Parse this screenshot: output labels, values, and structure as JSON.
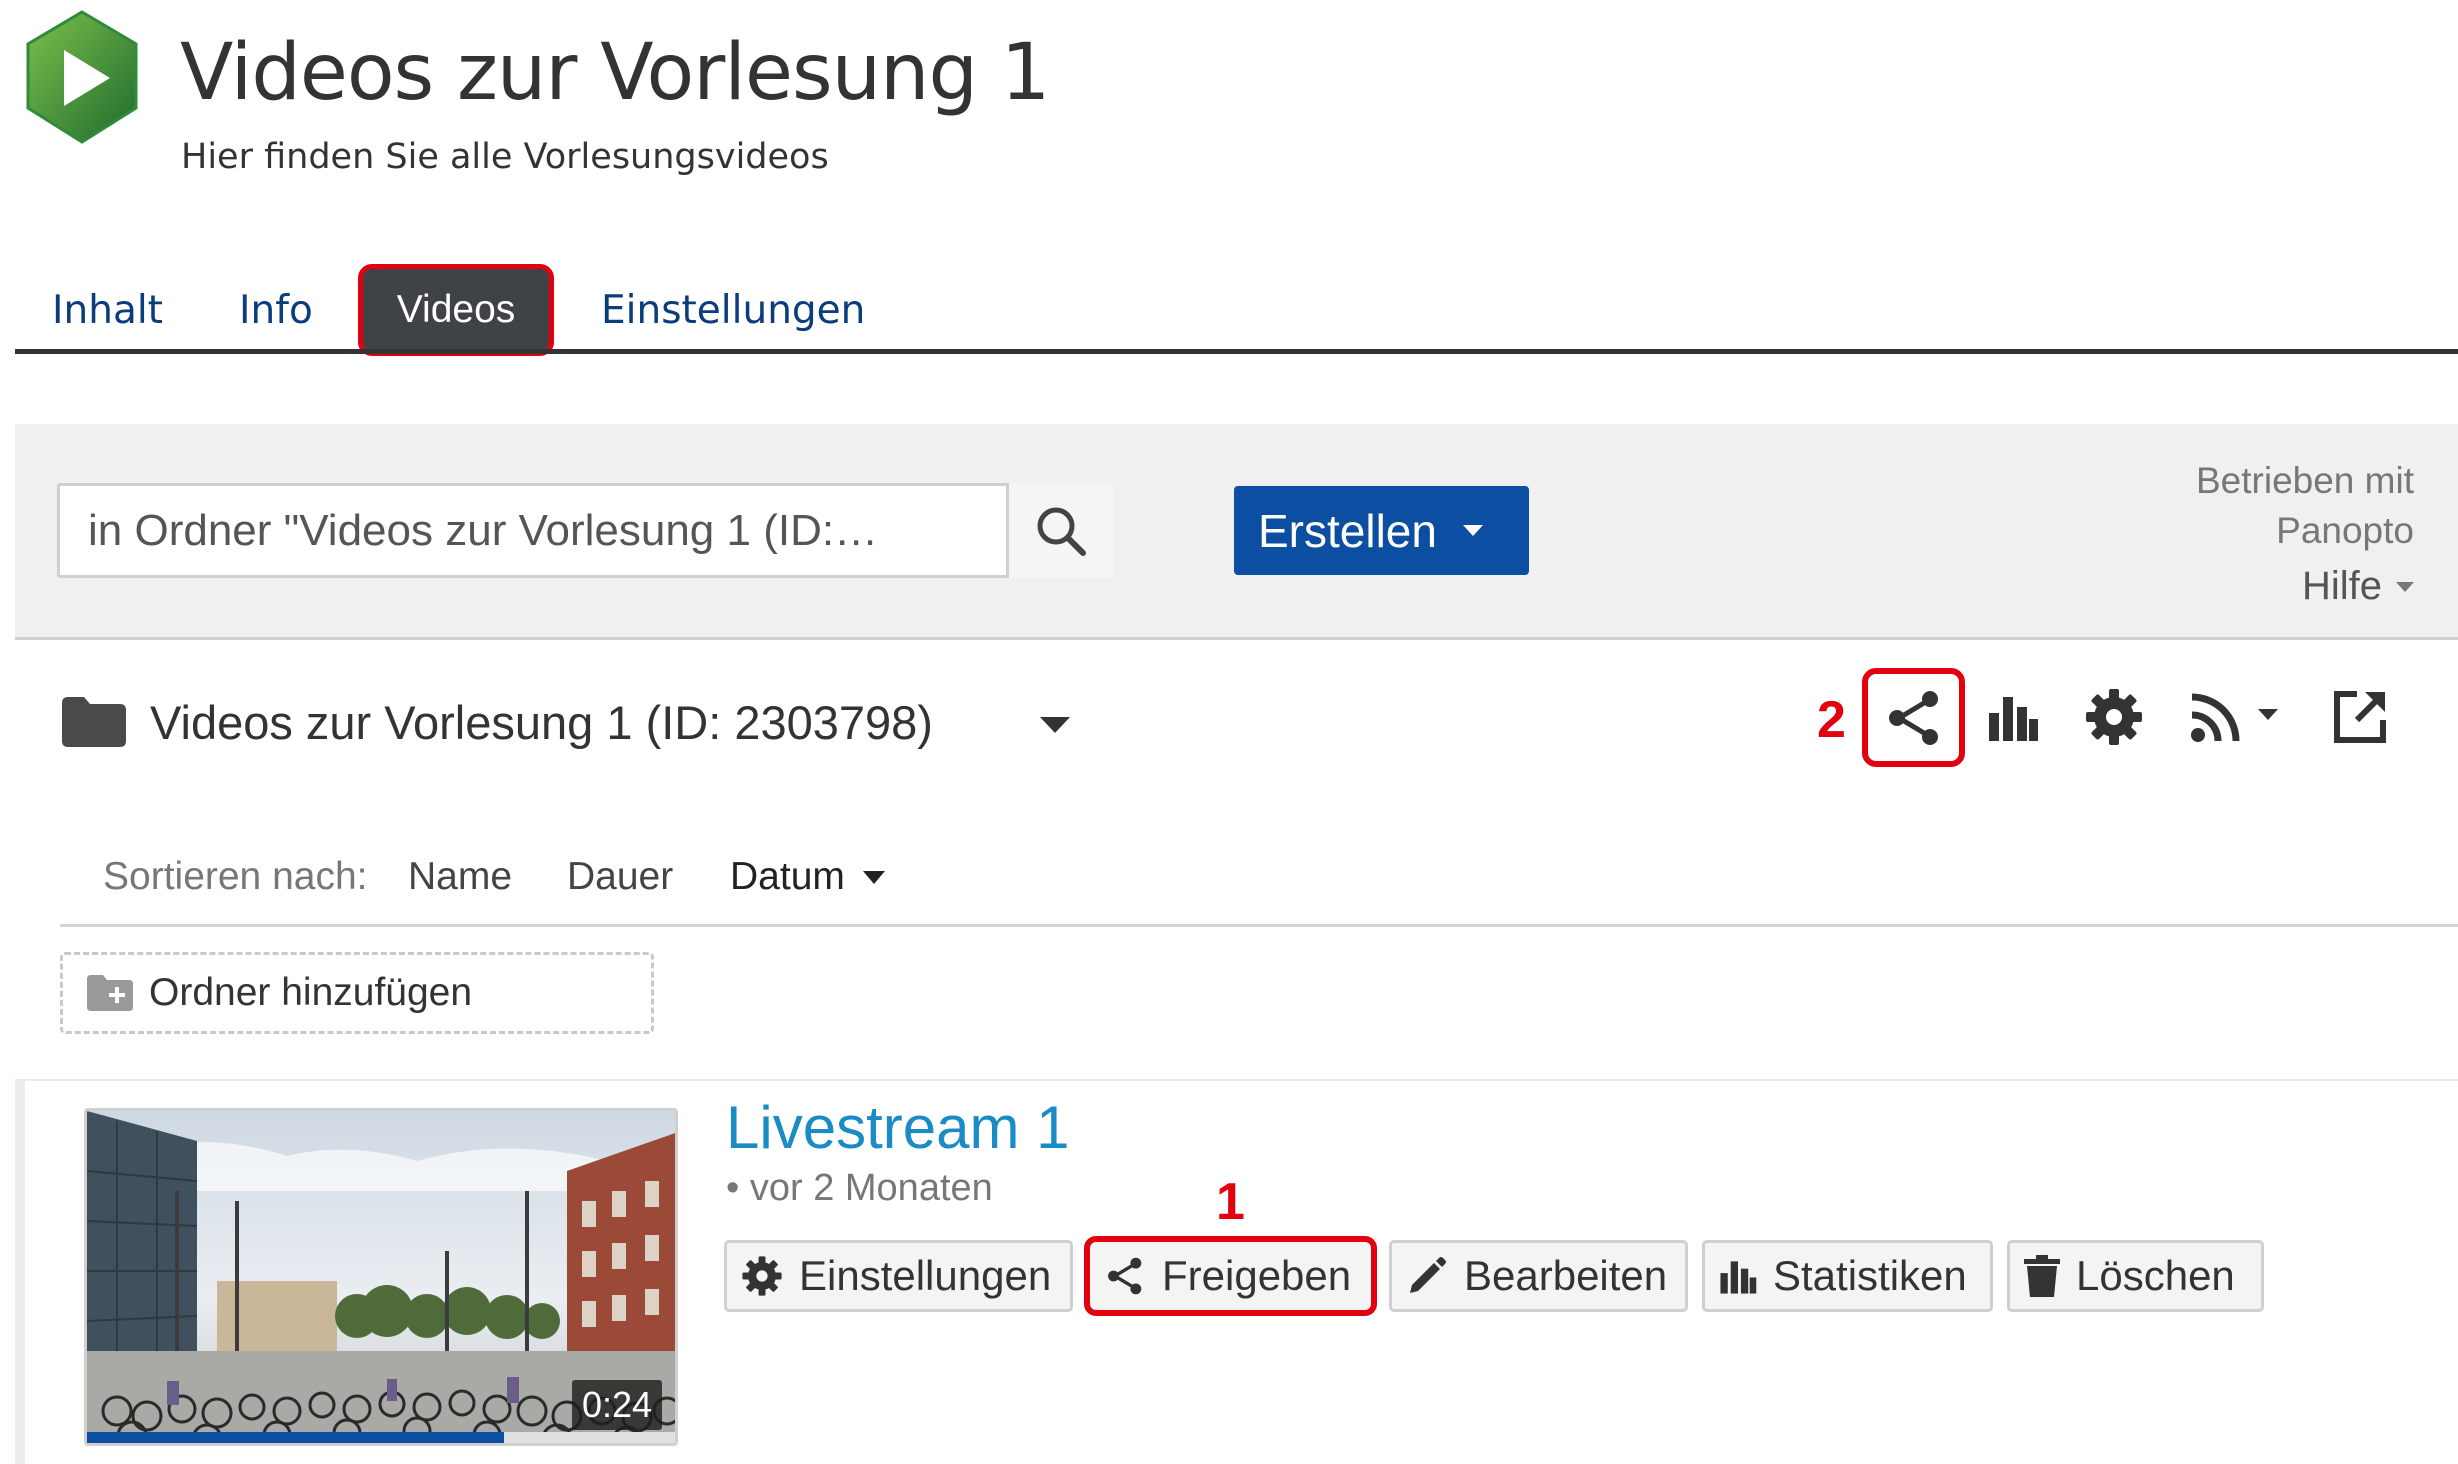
{
  "header": {
    "title": "Videos zur Vorlesung 1",
    "subtitle": "Hier finden Sie alle Vorlesungsvideos",
    "logo_icon": "panopto-logo-icon"
  },
  "tabs": [
    {
      "label": "Inhalt"
    },
    {
      "label": "Info"
    },
    {
      "label": "Videos",
      "active": true
    },
    {
      "label": "Einstellungen"
    }
  ],
  "toolbar": {
    "search_value": "in Ordner \"Videos zur Vorlesung 1 (ID:…",
    "create_label": "Erstellen",
    "powered_line1": "Betrieben mit",
    "powered_line2": "Panopto",
    "help_label": "Hilfe"
  },
  "folder": {
    "title": "Videos zur Vorlesung 1 (ID: 2303798)",
    "icons": [
      "share-icon",
      "stats-icon",
      "settings-icon",
      "rss-icon",
      "open-external-icon"
    ]
  },
  "annotations": {
    "marker_1": "1",
    "marker_2": "2"
  },
  "sort": {
    "label": "Sortieren nach:",
    "options": [
      "Name",
      "Dauer",
      "Datum"
    ],
    "active": "Datum"
  },
  "add_folder_label": "Ordner hinzufügen",
  "session": {
    "title": "Livestream 1",
    "date": "• vor 2 Monaten",
    "duration": "0:24",
    "progress": 0.71,
    "actions": [
      "Einstellungen",
      "Freigeben",
      "Bearbeiten",
      "Statistiken",
      "Löschen"
    ]
  },
  "colors": {
    "accent_blue": "#0b4ea2",
    "link_blue": "#1a8bc4",
    "highlight_red": "#e3000f",
    "tab_active_bg": "#3f4247"
  }
}
